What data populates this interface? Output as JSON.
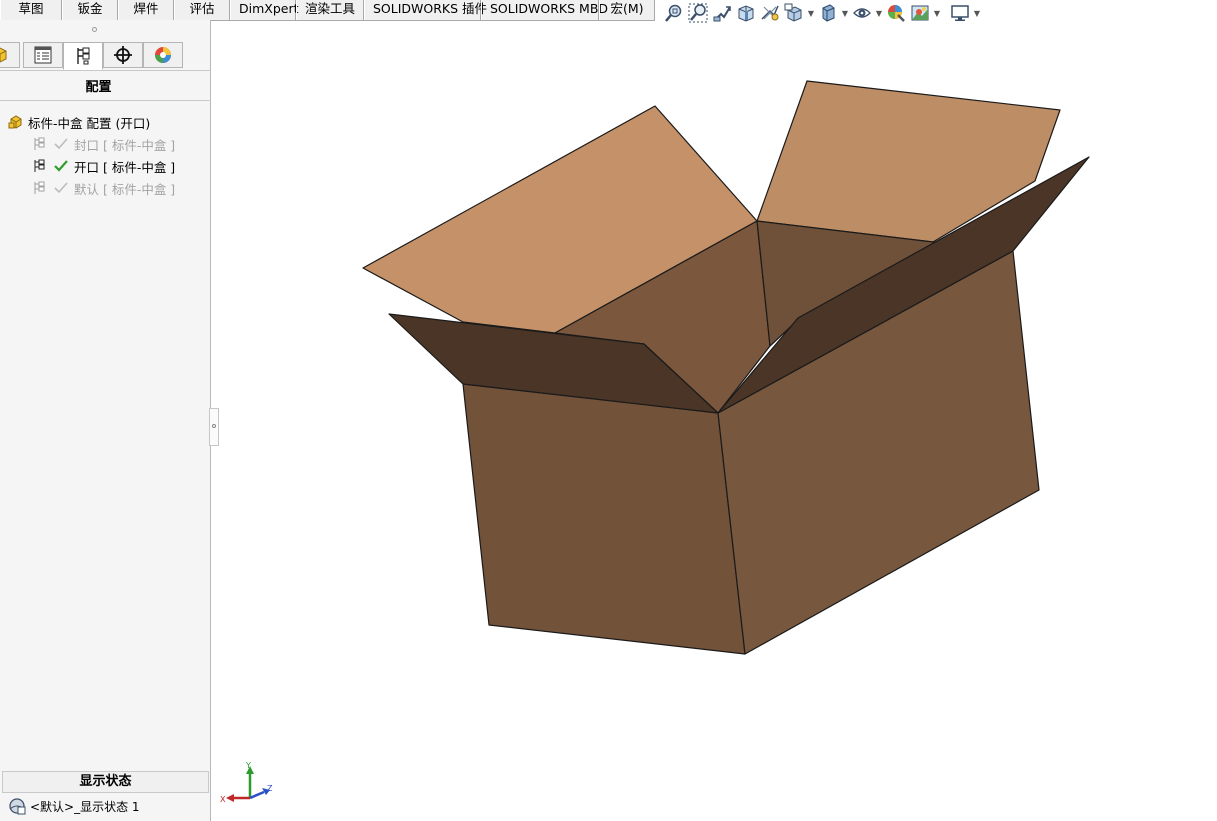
{
  "command_tabs": [
    "草图",
    "钣金",
    "焊件",
    "评估",
    "DimXpert",
    "渲染工具",
    "SOLIDWORKS 插件",
    "SOLIDWORKS MBD",
    "宏(M)"
  ],
  "view_toolbar": [
    {
      "icon": "zoom-to-fit-icon"
    },
    {
      "icon": "zoom-to-area-icon"
    },
    {
      "icon": "previous-view-icon"
    },
    {
      "icon": "section-view-icon"
    },
    {
      "icon": "dynamic-annotation-view-icon"
    },
    {
      "icon": "view-orientation-icon",
      "dropdown": true
    },
    {
      "icon": "display-style-icon",
      "dropdown": true
    },
    {
      "icon": "hide-show-items-icon",
      "dropdown": true
    },
    {
      "icon": "edit-appearance-icon"
    },
    {
      "icon": "apply-scene-icon",
      "dropdown": true
    },
    {
      "icon": "view-settings-icon",
      "dropdown": true
    }
  ],
  "panel": {
    "tabs": [
      {
        "icon": "feature-manager-icon"
      },
      {
        "icon": "property-manager-icon"
      },
      {
        "icon": "configuration-manager-icon",
        "active": true
      },
      {
        "icon": "dimxpert-manager-icon"
      },
      {
        "icon": "display-manager-icon"
      }
    ],
    "title": "配置",
    "root": {
      "label": "标件-中盒 配置  (开口)"
    },
    "configs": [
      {
        "label": "封口 [ 标件-中盒 ]",
        "active": false
      },
      {
        "label": "开口 [ 标件-中盒 ]",
        "active": true
      },
      {
        "label": "默认 [ 标件-中盒 ]",
        "active": false
      }
    ],
    "display_state_header": "显示状态",
    "display_state_item": "<默认>_显示状态 1"
  },
  "triad": {
    "x": "X",
    "y": "Y",
    "z": "Z"
  },
  "colors": {
    "box_front": "#73523a",
    "box_inner": "#7a573d",
    "flap_light": "#c49168",
    "flap_dark": "#4a3527",
    "accent_green": "#2e9d2e"
  }
}
